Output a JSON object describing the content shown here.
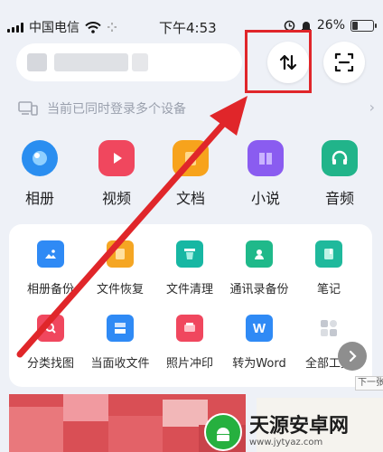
{
  "status_bar": {
    "carrier": "中国电信",
    "time": "下午4:53",
    "battery": "26%"
  },
  "search": {
    "placeholder": ""
  },
  "device_bar": {
    "text": "当前已同时登录多个设备"
  },
  "categories": [
    {
      "label": "相册",
      "icon": "album-icon",
      "color": "#2a8ef0"
    },
    {
      "label": "视频",
      "icon": "video-icon",
      "color": "#f0475e"
    },
    {
      "label": "文档",
      "icon": "document-icon",
      "color": "#f7a31c"
    },
    {
      "label": "小说",
      "icon": "novel-icon",
      "color": "#8a5cf0"
    },
    {
      "label": "音频",
      "icon": "audio-icon",
      "color": "#21b48a"
    }
  ],
  "tools": [
    {
      "label": "相册备份",
      "icon": "album-backup-icon",
      "color": "#2f8af5"
    },
    {
      "label": "文件恢复",
      "icon": "file-restore-icon",
      "color": "#f5a623"
    },
    {
      "label": "文件清理",
      "icon": "file-clean-icon",
      "color": "#17b7a3"
    },
    {
      "label": "通讯录备份",
      "icon": "contacts-backup-icon",
      "color": "#1fb98a"
    },
    {
      "label": "笔记",
      "icon": "notes-icon",
      "color": "#1fb99c"
    },
    {
      "label": "分类找图",
      "icon": "image-search-icon",
      "color": "#f0475e"
    },
    {
      "label": "当面收文件",
      "icon": "receive-file-icon",
      "color": "#2f8af5"
    },
    {
      "label": "照片冲印",
      "icon": "photo-print-icon",
      "color": "#f0475e"
    },
    {
      "label": "转为Word",
      "icon": "word-convert-icon",
      "color": "#2f8af5"
    },
    {
      "label": "全部工具",
      "icon": "all-tools-icon",
      "color": "#c4c8d0"
    }
  ],
  "next_tip": "下一张",
  "watermark": {
    "title": "天源安卓网",
    "url": "www.jytyaz.com"
  }
}
